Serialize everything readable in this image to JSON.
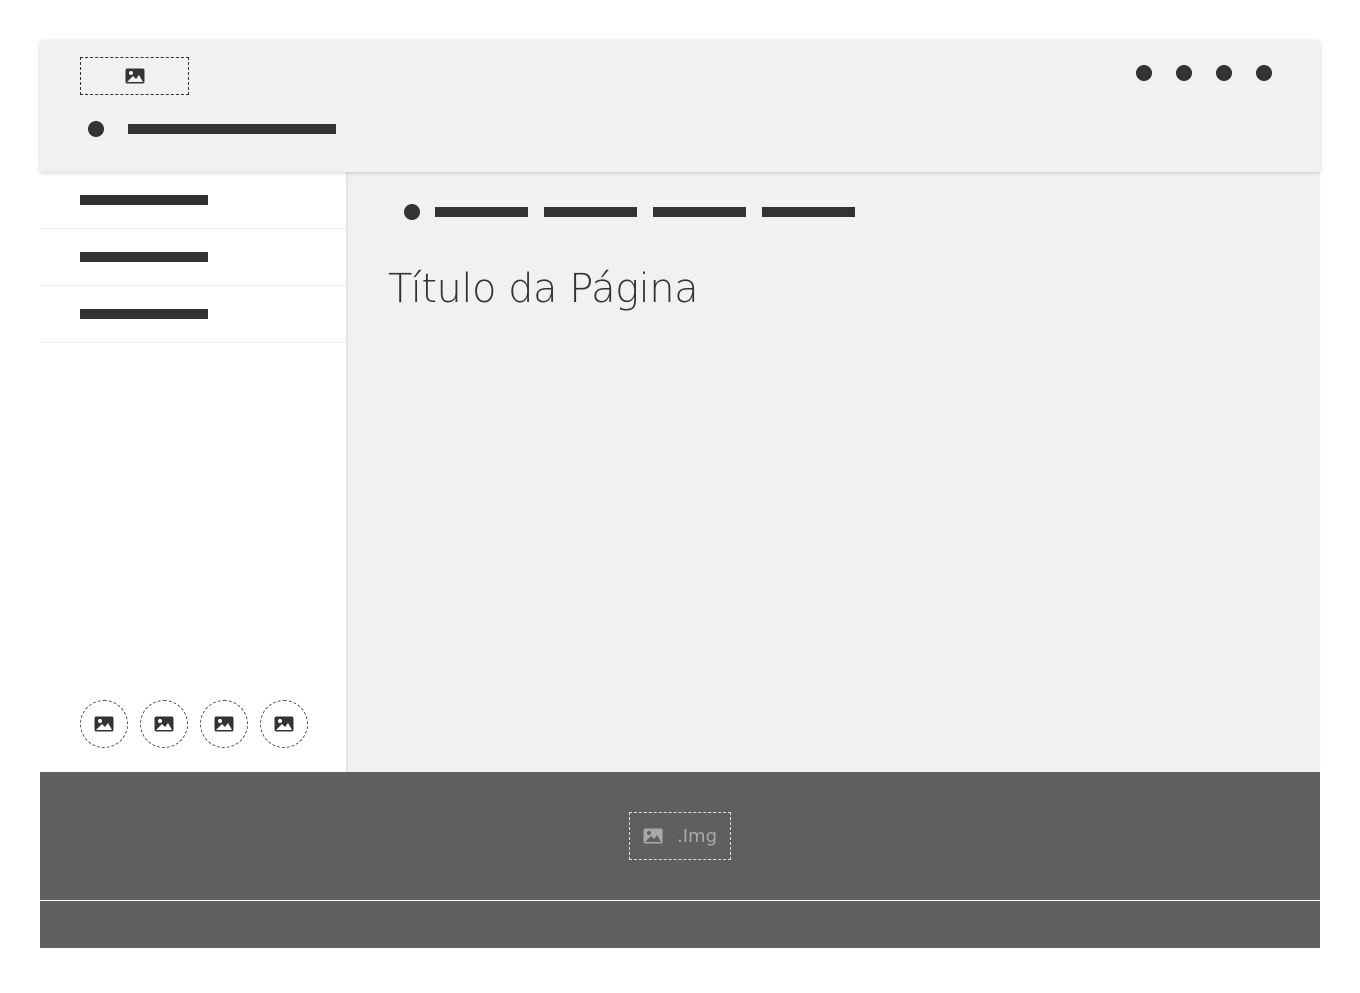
{
  "header": {
    "logo": {
      "icon": "image-icon"
    },
    "action_count": 4,
    "user": {
      "icon": "dot-icon"
    }
  },
  "sidebar": {
    "items": [
      {
        "label": ""
      },
      {
        "label": ""
      },
      {
        "label": ""
      }
    ],
    "social_icons": [
      "image-icon",
      "image-icon",
      "image-icon",
      "image-icon"
    ]
  },
  "main": {
    "breadcrumb_count": 4,
    "page_title": "Título da Página"
  },
  "footer": {
    "image_label": ".Img",
    "icon": "image-icon"
  },
  "colors": {
    "header_bg": "#f2f0f1",
    "main_bg": "#f2f0f1",
    "sidebar_bg": "#ffffff",
    "footer_bg": "#5f5f5f",
    "placeholder_dark": "#333333"
  }
}
